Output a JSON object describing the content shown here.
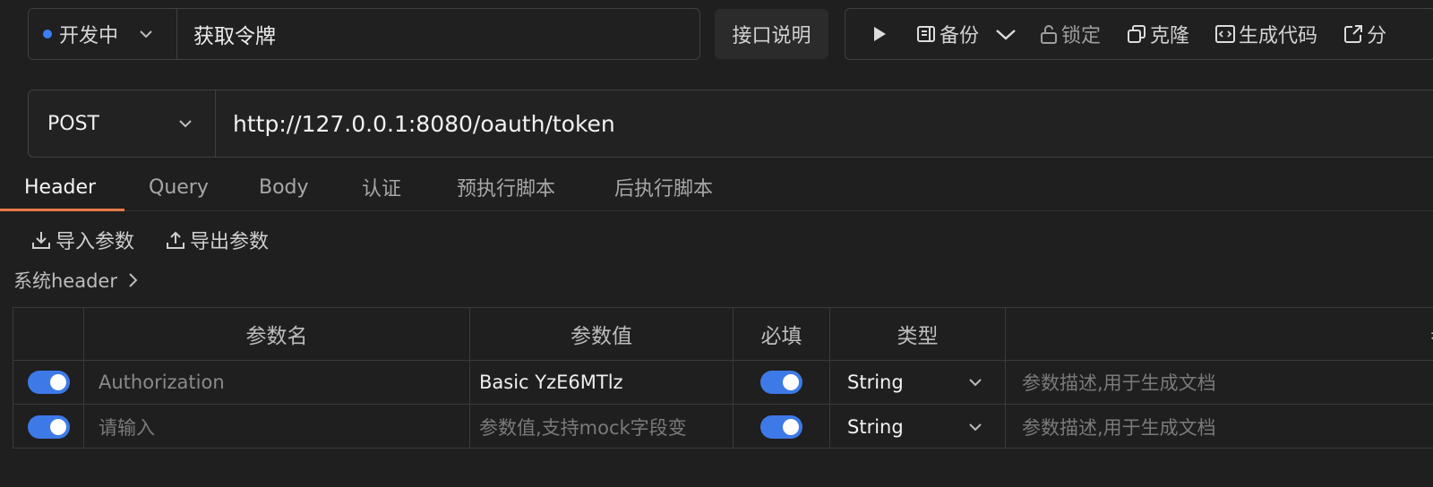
{
  "header": {
    "status": "开发中",
    "api_name": "获取令牌",
    "doc_button": "接口说明",
    "toolbar": {
      "backup": "备份",
      "lock": "锁定",
      "clone": "克隆",
      "gen_code": "生成代码",
      "share": "分"
    }
  },
  "request": {
    "method": "POST",
    "url": "http://127.0.0.1:8080/oauth/token"
  },
  "tabs": [
    "Header",
    "Query",
    "Body",
    "认证",
    "预执行脚本",
    "后执行脚本"
  ],
  "actions": {
    "import": "导入参数",
    "export": "导出参数"
  },
  "system_header": "系统header",
  "table": {
    "columns": [
      "参数名",
      "参数值",
      "必填",
      "类型",
      "参"
    ],
    "rows": [
      {
        "enabled": true,
        "name": "Authorization",
        "value": "Basic YzE6MTlz",
        "required": true,
        "type": "String",
        "description_placeholder": "参数描述,用于生成文档"
      },
      {
        "enabled": true,
        "name_placeholder": "请输入",
        "value_placeholder": "参数值,支持mock字段变",
        "required": true,
        "type": "String",
        "description_placeholder": "参数描述,用于生成文档"
      }
    ]
  },
  "colors": {
    "accent": "#e67a45",
    "toggle": "#3d7ae8",
    "status_dot": "#3d7df5"
  }
}
